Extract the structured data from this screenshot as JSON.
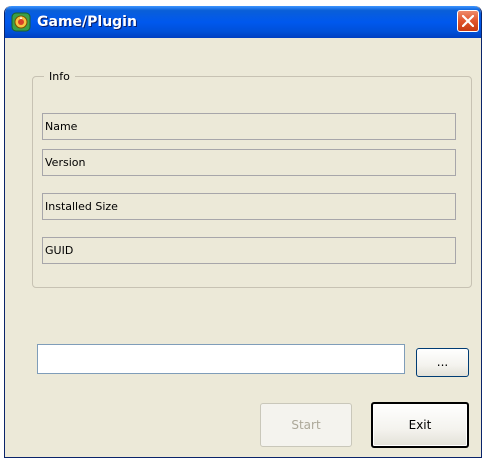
{
  "window": {
    "title": "Game/Plugin",
    "icon": "app-logo-icon",
    "close_icon": "close-icon",
    "colors": {
      "titlebar": "#0058ee",
      "body": "#ece9d8",
      "close": "#e0542c"
    }
  },
  "info_group": {
    "legend": "Info",
    "rows": [
      {
        "label": "Name"
      },
      {
        "label": "Version"
      },
      {
        "label": "Installed Size"
      },
      {
        "label": "GUID"
      }
    ]
  },
  "path": {
    "value": "",
    "placeholder": ""
  },
  "buttons": {
    "browse": "...",
    "start": "Start",
    "exit": "Exit"
  }
}
